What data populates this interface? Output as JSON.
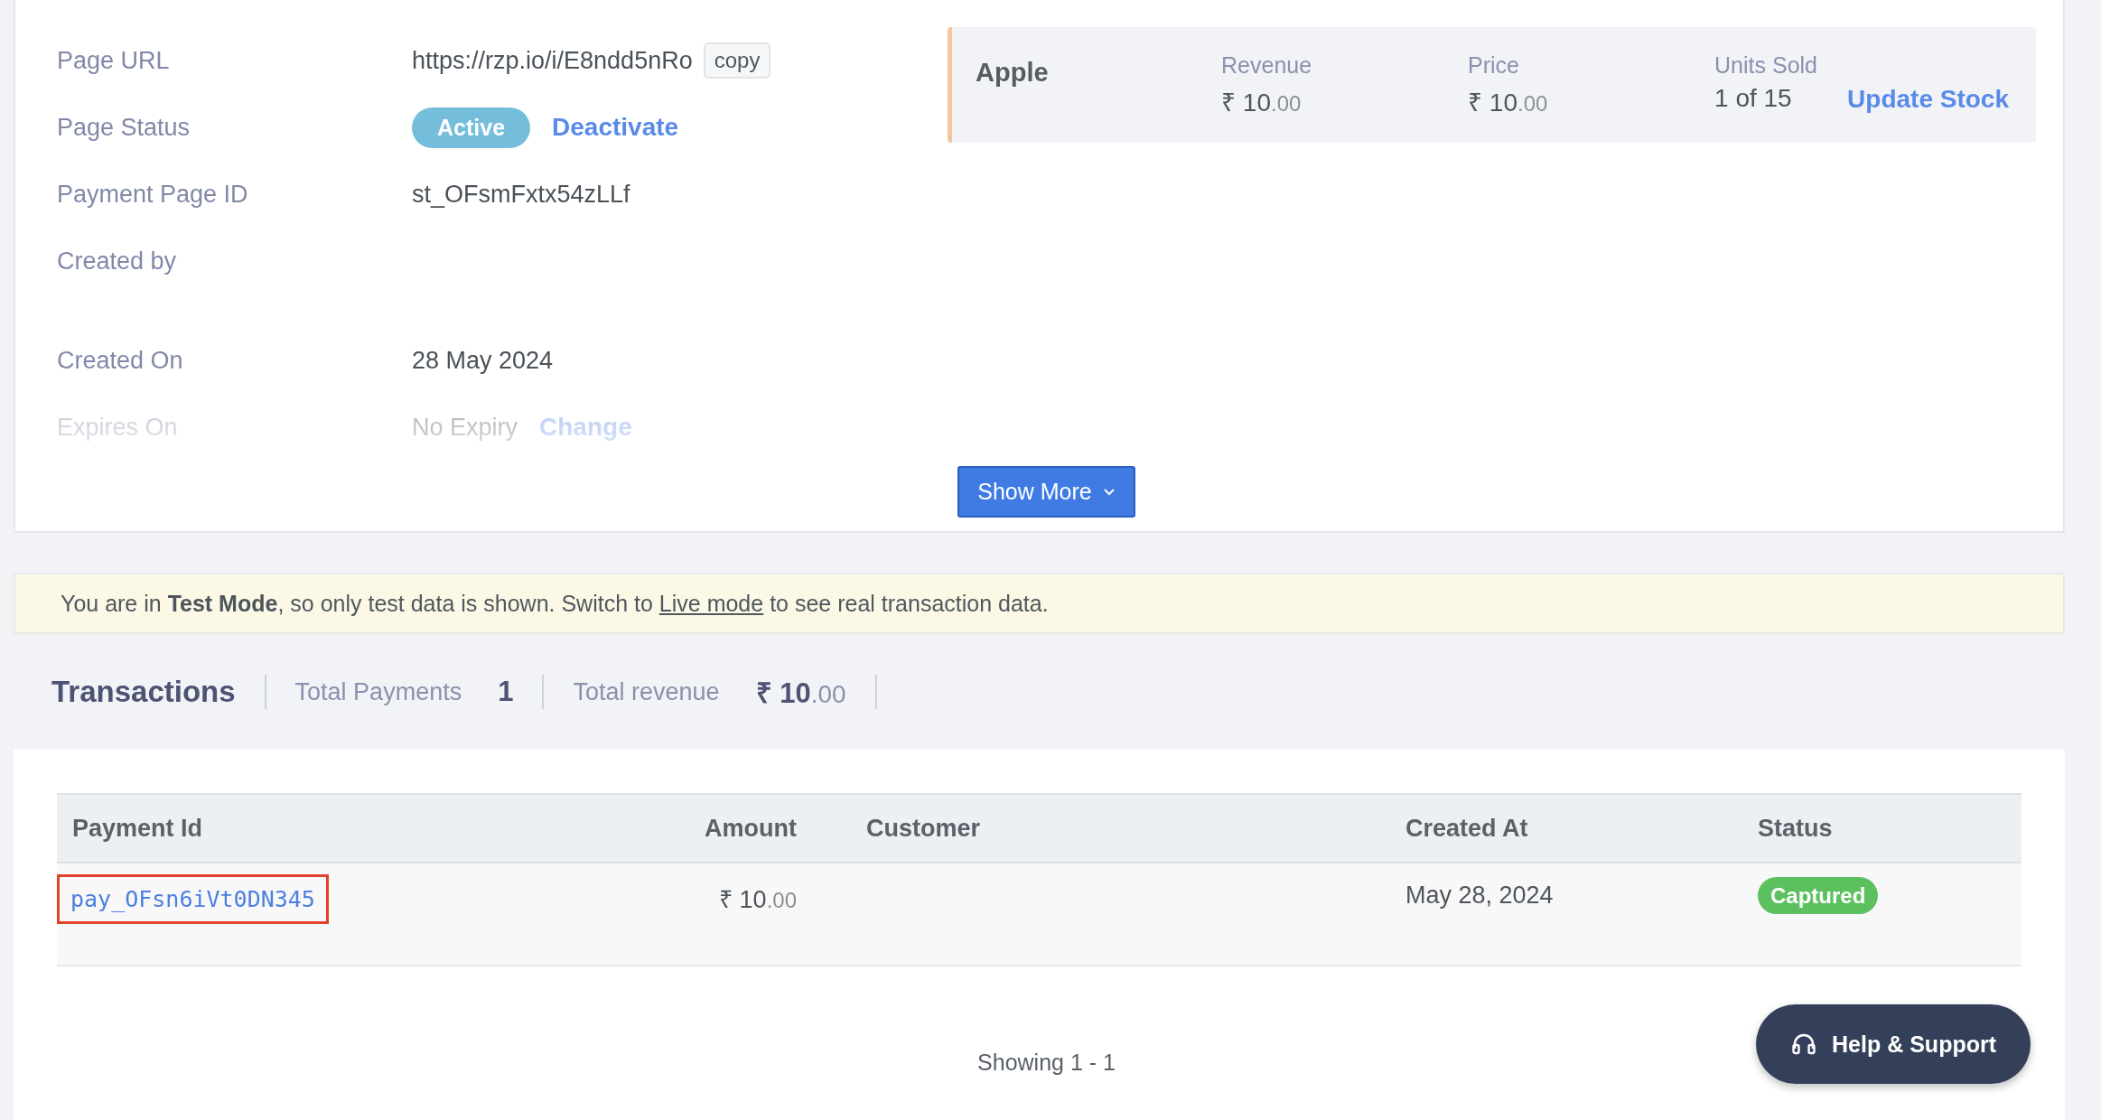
{
  "details": [
    {
      "kind": "link",
      "label": "Page URL",
      "value": "https://rzp.io/i/E8ndd5nRo",
      "button": "copy"
    },
    {
      "kind": "status",
      "label": "Page Status",
      "badge": "Active",
      "action": "Deactivate"
    },
    {
      "kind": "text",
      "label": "Payment Page ID",
      "value": "st_OFsmFxtx54zLLf"
    },
    {
      "kind": "empty",
      "label": "Created by"
    },
    {
      "kind": "text",
      "label": "Created On",
      "value": "28 May 2024"
    },
    {
      "kind": "expiry",
      "label": "Expires On",
      "value": "No Expiry",
      "action": "Change"
    }
  ],
  "product": {
    "name": "Apple",
    "stats": [
      {
        "kind": "money",
        "label": "Revenue",
        "main": "₹ 10",
        "fraction": ".00"
      },
      {
        "kind": "money",
        "label": "Price",
        "main": "₹ 10",
        "fraction": ".00"
      },
      {
        "kind": "text",
        "label": "Units Sold",
        "value": "1 of 15"
      }
    ],
    "action": "Update Stock"
  },
  "show_more": "Show More",
  "banner": {
    "text": "You are in **Test Mode**, so only test data is shown. Switch to",
    "link": "Live mode",
    "after": "to see real transaction data."
  },
  "summary": {
    "title": "Transactions",
    "items": [
      {
        "kind": "count",
        "label": "Total Payments",
        "value": "1"
      },
      {
        "kind": "money",
        "label": "Total revenue",
        "main": "₹ 10",
        "fraction": ".00"
      }
    ]
  },
  "table": {
    "columns": [
      "Payment Id",
      "Amount",
      "Customer",
      "Created At",
      "Status"
    ],
    "rows": [
      {
        "payment_id": "pay_OFsn6iVt0DN345",
        "highlighted": true,
        "amount_main": "₹ 10",
        "amount_fraction": ".00",
        "created_at": "May 28, 2024",
        "status": {
          "label": "Captured",
          "color": "#5cc05f"
        }
      }
    ]
  },
  "pagination": "Showing 1 - 1",
  "help_button": "Help & Support"
}
